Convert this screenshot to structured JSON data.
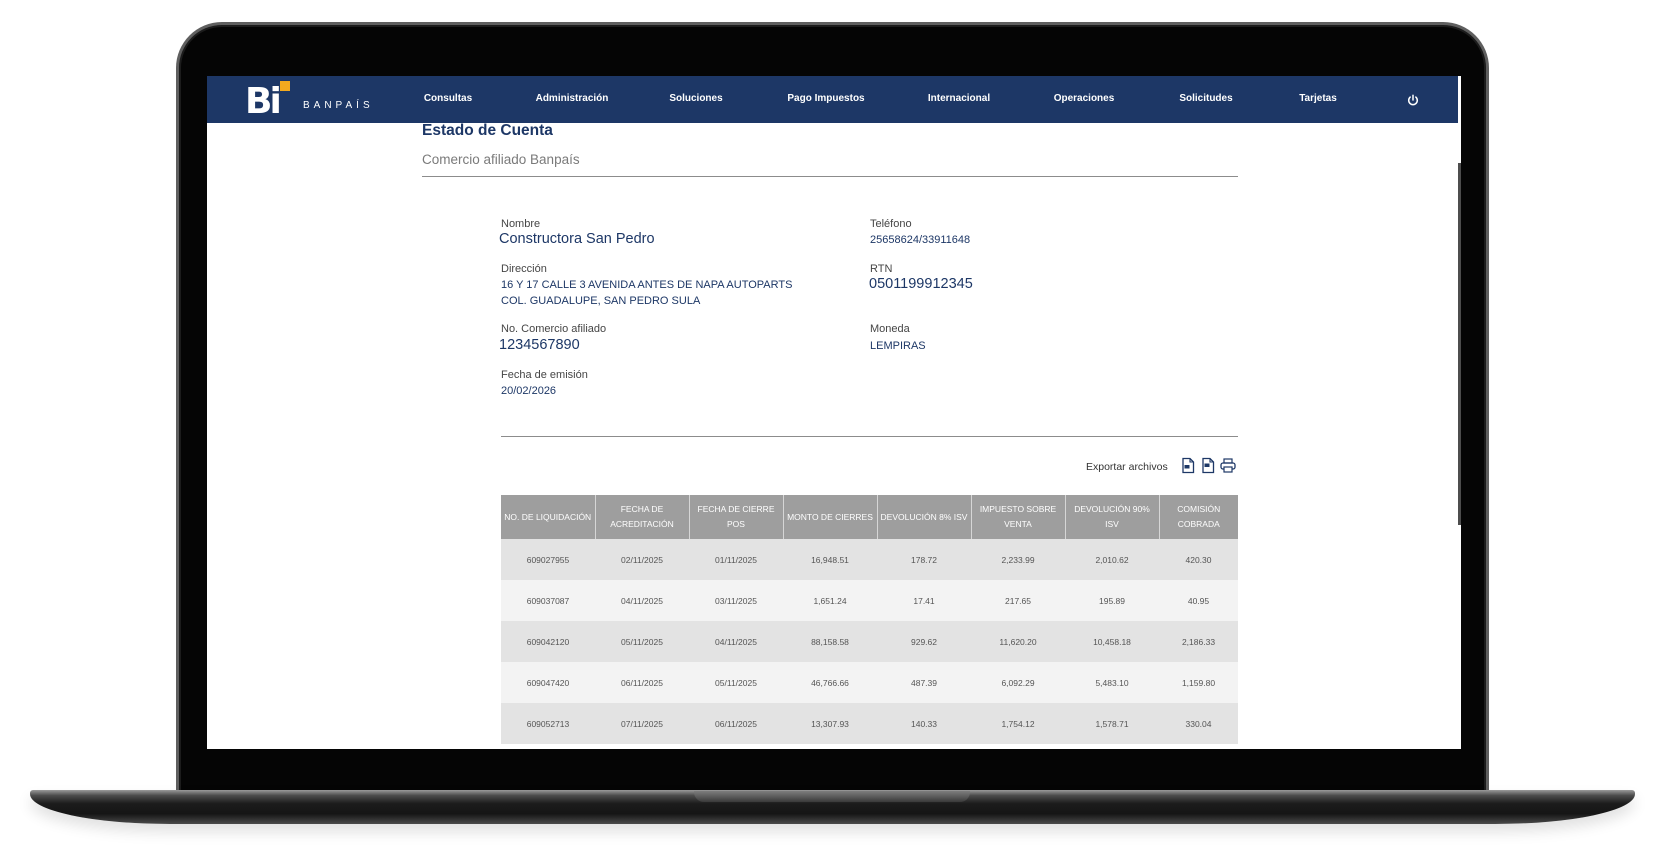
{
  "brand": {
    "name": "BANPAÍS",
    "mark": "Bi",
    "colors": {
      "navy": "#1d3766",
      "gold": "#f2a91f"
    }
  },
  "nav": {
    "items": [
      "Consultas",
      "Administración",
      "Soluciones",
      "Pago Impuestos",
      "Internacional",
      "Operaciones",
      "Solicitudes",
      "Tarjetas"
    ],
    "logout_icon": "power-icon"
  },
  "page": {
    "title": "Estado de Cuenta",
    "subtitle": "Comercio afiliado Banpaís"
  },
  "details": {
    "nombre": {
      "label": "Nombre",
      "value": "Constructora San Pedro"
    },
    "telefono": {
      "label": "Teléfono",
      "value": "25658624/33911648"
    },
    "direccion": {
      "label": "Dirección",
      "line1": "16 Y 17 CALLE 3 AVENIDA ANTES DE NAPA AUTOPARTS",
      "line2": "COL. GUADALUPE, SAN PEDRO SULA"
    },
    "rtn": {
      "label": "RTN",
      "value": "0501199912345"
    },
    "comercio": {
      "label": "No. Comercio afiliado",
      "value": "1234567890"
    },
    "moneda": {
      "label": "Moneda",
      "value": "LEMPIRAS"
    },
    "fecha_emision": {
      "label": "Fecha de emisión",
      "value": "20/02/2026"
    }
  },
  "export": {
    "label": "Exportar archivos",
    "icons": [
      "pdf-file-icon",
      "excel-file-icon",
      "printer-icon"
    ]
  },
  "table": {
    "headers": [
      "NO. DE LIQUIDACIÓN",
      "FECHA DE ACREDITACIÓN",
      "FECHA DE CIERRE POS",
      "MONTO DE CIERRES",
      "DEVOLUCIÓN 8% ISV",
      "IMPUESTO SOBRE VENTA",
      "DEVOLUCIÓN 90% ISV",
      "COMISIÓN COBRADA"
    ],
    "rows": [
      [
        "609027955",
        "02/11/2025",
        "01/11/2025",
        "16,948.51",
        "178.72",
        "2,233.99",
        "2,010.62",
        "420.30"
      ],
      [
        "609037087",
        "04/11/2025",
        "03/11/2025",
        "1,651.24",
        "17.41",
        "217.65",
        "195.89",
        "40.95"
      ],
      [
        "609042120",
        "05/11/2025",
        "04/11/2025",
        "88,158.58",
        "929.62",
        "11,620.20",
        "10,458.18",
        "2,186.33"
      ],
      [
        "609047420",
        "06/11/2025",
        "05/11/2025",
        "46,766.66",
        "487.39",
        "6,092.29",
        "5,483.10",
        "1,159.80"
      ],
      [
        "609052713",
        "07/11/2025",
        "06/11/2025",
        "13,307.93",
        "140.33",
        "1,754.12",
        "1,578.71",
        "330.04"
      ]
    ]
  }
}
